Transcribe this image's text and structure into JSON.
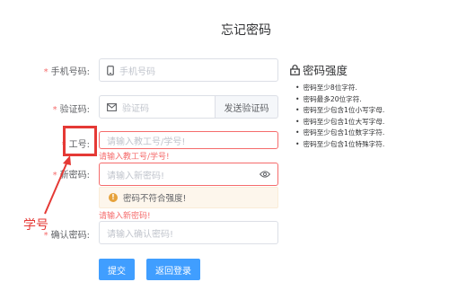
{
  "page_title": "忘记密码",
  "form": {
    "required_mark": "*",
    "phone": {
      "label": "手机号码:",
      "placeholder": "手机号码",
      "icon": "mobile-phone-icon"
    },
    "code": {
      "label": "验证码:",
      "placeholder": "验证码",
      "icon": "envelope-icon",
      "button": "发送验证码"
    },
    "work_id": {
      "label": "工号:",
      "placeholder": "请输入教工号/学号!",
      "error": "请输入教工号/学号!"
    },
    "new_password": {
      "label": "新密码:",
      "placeholder": "请输入新密码!",
      "icon": "eye-icon",
      "warning": "密码不符合强度!",
      "warning_icon": "!",
      "error": "请输入新密码!"
    },
    "confirm_password": {
      "label": "确认密码:",
      "placeholder": "请输入确认密码!"
    },
    "submit": "提交",
    "back": "返回登录"
  },
  "strength": {
    "title": "密码强度",
    "icon": "lock-icon",
    "rules": [
      "密码至少8位字符.",
      "密码最多20位字符.",
      "密码至少包含1位小写字母.",
      "密码至少包含1位大写字母.",
      "密码至少包含1位数字字符.",
      "密码至少包含1位特殊字符."
    ]
  },
  "annotation": {
    "label": "学号",
    "color": "#e53935"
  },
  "colors": {
    "primary": "#409eff",
    "danger": "#f56c6c",
    "warning": "#e6a23c"
  }
}
